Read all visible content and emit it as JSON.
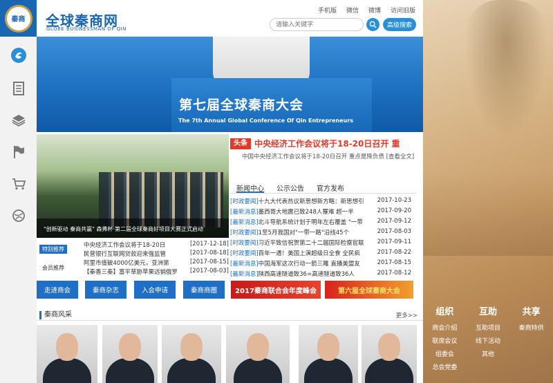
{
  "header": {
    "site_title": "全球秦商网",
    "site_subtitle": "GLOBE BUSINESSMAN OF QIN",
    "logo_text": "秦商",
    "top_links": [
      "手机版",
      "微信",
      "微博",
      "访问旧版"
    ],
    "search_placeholder": "请输入关键字",
    "advanced_search_label": "高级搜索"
  },
  "left_nav": {
    "icons": [
      "home-icon",
      "document-icon",
      "layers-icon",
      "flag-icon",
      "cart-icon",
      "globe-icon"
    ]
  },
  "hero": {
    "title": "第七届全球秦商大会",
    "subtitle": "The 7th Annual Global Conference Of Qin Entrepreneurs"
  },
  "photo": {
    "caption": "\"创新驱动 秦商共赢\" 森弗杯·第二届全球秦商好项目大赛正式启动"
  },
  "headline": {
    "tag": "头条",
    "title": "中央经济工作会议将于18-20日召开 重",
    "summary": "中国中央经济工作会议将于18-20日召开 重点是降负债 [查看全文]"
  },
  "tabs": [
    "新闻中心",
    "公示公告",
    "官方发布"
  ],
  "news_list": [
    {
      "tag": "[时政要闻]",
      "title": "十九大代表热议新思想新方略：新思想引",
      "date": "2017-10-23"
    },
    {
      "tag": "[最新消息]",
      "title": "墨西哥大地震已致248人罹难 超一半",
      "date": "2017-09-20"
    },
    {
      "tag": "[最新消息]",
      "title": "北斗导航系统计划于明年左右覆盖 \"一带",
      "date": "2017-09-12"
    },
    {
      "tag": "[时政要闻]",
      "title": "1至5月我国对\"一带一路\"沿线45个",
      "date": "2017-08-03"
    },
    {
      "tag": "[时政要闻]",
      "title": "习近平致信祝贺第二十二届国际检察官联",
      "date": "2017-09-11"
    },
    {
      "tag": "[时政要闻]",
      "title": "百年一遇！美国上演超级日全食 全民疯",
      "date": "2017-08-22"
    },
    {
      "tag": "[最新消息]",
      "title": "中国海军这次行动一箭三雕 直播美盟友",
      "date": "2017-08-15"
    },
    {
      "tag": "[最新消息]",
      "title": "陕西高速隧道致36=高速隧道致36人",
      "date": "2017-08-12"
    }
  ],
  "left_news": {
    "tag_hot": "特别推荐",
    "tag_member": "会员推荐",
    "rows": [
      {
        "title": "中央经济工作会议将于18-20日",
        "date": "[2017-12-18]"
      },
      {
        "title": "民营银行互联网贷款迎来强监管",
        "date": "[2017-08-18]"
      },
      {
        "title": "阿里市值破4000亿美元，亚洲第",
        "date": "[2017-08-15]"
      },
      {
        "title": "【秦香三秦】富平草胁苹果远销俄罗",
        "date": "[2017-08-03]"
      }
    ]
  },
  "quick_buttons": [
    "走进商会",
    "秦商杂志",
    "入会申请",
    "秦商商圈"
  ],
  "banners": [
    "2017秦商联合会年度峰会",
    "第六届全球秦商大会"
  ],
  "section": {
    "title": "秦商风采",
    "more": "更多>>"
  },
  "right_panel": {
    "columns": [
      {
        "heading": "组织",
        "items": [
          "商会介绍",
          "联席会议",
          "组委会",
          "总会党委"
        ]
      },
      {
        "heading": "互助",
        "items": [
          "互助项目",
          "线下活动",
          "其他"
        ]
      },
      {
        "heading": "共享",
        "items": [
          "秦商特供"
        ]
      }
    ]
  }
}
